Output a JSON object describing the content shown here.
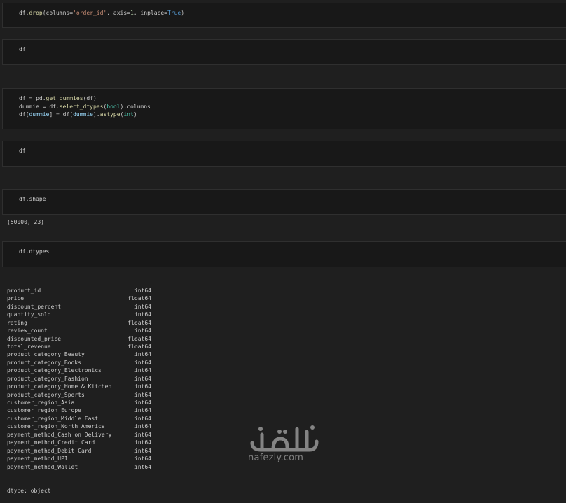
{
  "cells": [
    {
      "lines": [
        [
          [
            "df.",
            ""
          ],
          [
            "drop",
            "fn"
          ],
          [
            "(columns=",
            ""
          ],
          [
            "'order_id'",
            "str"
          ],
          [
            ", axis=",
            ""
          ],
          [
            "1",
            "num"
          ],
          [
            ", inplace=",
            ""
          ],
          [
            "True",
            "kw"
          ],
          [
            ")",
            ""
          ]
        ]
      ]
    },
    {
      "lines": [
        [
          [
            "df",
            ""
          ]
        ]
      ]
    },
    {
      "lines": [
        [
          [
            "df = pd.",
            ""
          ],
          [
            "get_dummies",
            "fn"
          ],
          [
            "(df)",
            ""
          ]
        ],
        [
          [
            "dummie = df.",
            ""
          ],
          [
            "select_dtypes",
            "fn"
          ],
          [
            "(",
            ""
          ],
          [
            "bool",
            "cls"
          ],
          [
            ").columns",
            ""
          ]
        ],
        [
          [
            "df[",
            ""
          ],
          [
            "dummie",
            "var"
          ],
          [
            "] = df[",
            ""
          ],
          [
            "dummie",
            "var"
          ],
          [
            "].",
            ""
          ],
          [
            "astype",
            "fn"
          ],
          [
            "(",
            ""
          ],
          [
            "int",
            "cls"
          ],
          [
            ")",
            ""
          ]
        ]
      ]
    },
    {
      "lines": [
        [
          [
            "df",
            ""
          ]
        ]
      ]
    },
    {
      "lines": [
        [
          [
            "df.shape",
            ""
          ]
        ]
      ]
    },
    {
      "lines": [
        [
          [
            "df.dtypes",
            ""
          ]
        ]
      ]
    }
  ],
  "shape_output": "(50000, 23)",
  "dtypes": [
    {
      "name": "product_id",
      "type": "int64"
    },
    {
      "name": "price",
      "type": "float64"
    },
    {
      "name": "discount_percent",
      "type": "int64"
    },
    {
      "name": "quantity_sold",
      "type": "int64"
    },
    {
      "name": "rating",
      "type": "float64"
    },
    {
      "name": "review_count",
      "type": "int64"
    },
    {
      "name": "discounted_price",
      "type": "float64"
    },
    {
      "name": "total_revenue",
      "type": "float64"
    },
    {
      "name": "product_category_Beauty",
      "type": "int64"
    },
    {
      "name": "product_category_Books",
      "type": "int64"
    },
    {
      "name": "product_category_Electronics",
      "type": "int64"
    },
    {
      "name": "product_category_Fashion",
      "type": "int64"
    },
    {
      "name": "product_category_Home & Kitchen",
      "type": "int64"
    },
    {
      "name": "product_category_Sports",
      "type": "int64"
    },
    {
      "name": "customer_region_Asia",
      "type": "int64"
    },
    {
      "name": "customer_region_Europe",
      "type": "int64"
    },
    {
      "name": "customer_region_Middle East",
      "type": "int64"
    },
    {
      "name": "customer_region_North America",
      "type": "int64"
    },
    {
      "name": "payment_method_Cash on Delivery",
      "type": "int64"
    },
    {
      "name": "payment_method_Credit Card",
      "type": "int64"
    },
    {
      "name": "payment_method_Debit Card",
      "type": "int64"
    },
    {
      "name": "payment_method_UPI",
      "type": "int64"
    },
    {
      "name": "payment_method_Wallet",
      "type": "int64"
    }
  ],
  "dtype_footer": "dtype: object",
  "watermark": {
    "arabic": "نفذلي",
    "url": "nafezly.com"
  }
}
